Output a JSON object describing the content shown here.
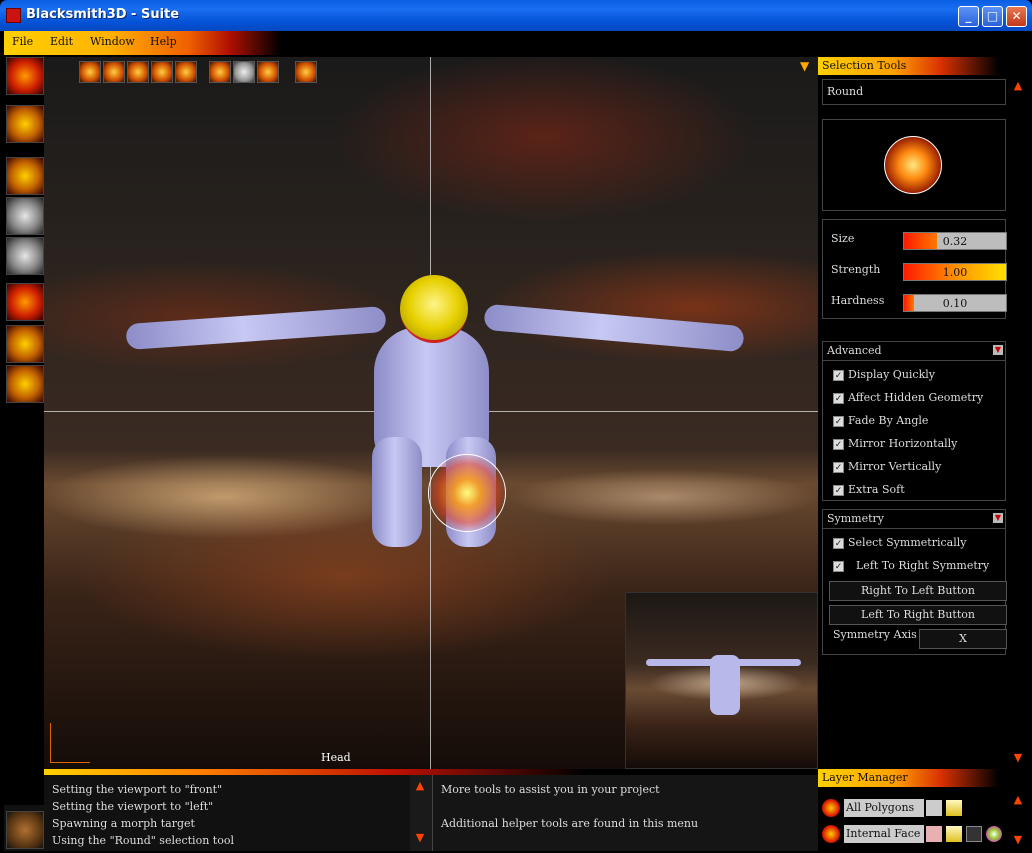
{
  "window": {
    "title": "Blacksmith3D - Suite",
    "minimize": "_",
    "maximize": "□",
    "close": "✕"
  },
  "menu": [
    "File",
    "Edit",
    "Window",
    "Help"
  ],
  "viewport": {
    "label": "Head",
    "corner_icon": "triangle-down-icon"
  },
  "selection_tools": {
    "header": "Selection Tools",
    "brush_type": "Round",
    "sliders": [
      {
        "label": "Size",
        "value": "0.32",
        "level": 0.32
      },
      {
        "label": "Strength",
        "value": "1.00",
        "level": 1.0
      },
      {
        "label": "Hardness",
        "value": "0.10",
        "level": 0.1
      }
    ],
    "advanced": {
      "title": "Advanced",
      "options": [
        "Display Quickly",
        "Affect Hidden Geometry",
        "Fade By Angle",
        "Mirror Horizontally",
        "Mirror Vertically",
        "Extra Soft"
      ]
    },
    "symmetry": {
      "title": "Symmetry",
      "select_symmetrically": "Select Symmetrically",
      "left_to_right_symmetry": "Left To Right Symmetry",
      "right_to_left_button": "Right To Left Button",
      "left_to_right_button": "Left To Right Button",
      "axis_label": "Symmetry Axis",
      "axis_value": "X"
    }
  },
  "log": [
    "Setting the viewport to \"front\"",
    "Setting the viewport to \"left\"",
    "Spawning a morph target",
    "Using the \"Round\" selection tool"
  ],
  "help": {
    "line1": "More tools to assist you in your project",
    "line2": "Additional helper tools are found in this menu"
  },
  "layer_manager": {
    "header": "Layer Manager",
    "layers": [
      "All Polygons",
      "Internal Face M"
    ]
  },
  "colors": {
    "accent_yellow": "#ffd000",
    "accent_orange": "#ff7a00",
    "accent_red": "#d83000",
    "titlebar_blue": "#0a5ee3"
  }
}
